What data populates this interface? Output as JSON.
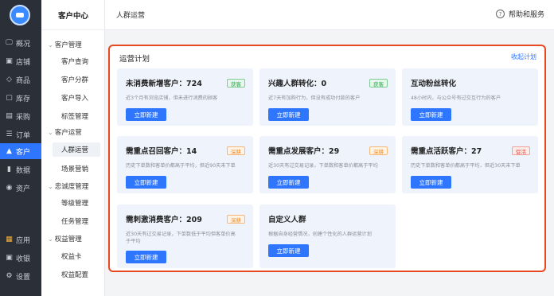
{
  "colors": {
    "accent": "#2f76ff",
    "highlight_border": "#e8481f",
    "rail_bg": "#2b2f38"
  },
  "rail": {
    "items": [
      {
        "label": "概况",
        "icon": "monitor-icon",
        "glyph": "🖵"
      },
      {
        "label": "店铺",
        "icon": "store-icon",
        "glyph": "▣"
      },
      {
        "label": "商品",
        "icon": "tag-icon",
        "glyph": "◇"
      },
      {
        "label": "库存",
        "icon": "box-icon",
        "glyph": "▢"
      },
      {
        "label": "采购",
        "icon": "cart-icon",
        "glyph": "▤"
      },
      {
        "label": "订单",
        "icon": "order-icon",
        "glyph": "☰"
      },
      {
        "label": "客户",
        "icon": "user-icon",
        "glyph": "▲"
      },
      {
        "label": "数据",
        "icon": "chart-icon",
        "glyph": "▮"
      },
      {
        "label": "资产",
        "icon": "asset-icon",
        "glyph": "◉"
      },
      {
        "label": "应用",
        "icon": "apps-icon",
        "glyph": "▦"
      },
      {
        "label": "收银",
        "icon": "cashier-icon",
        "glyph": "▣"
      },
      {
        "label": "设置",
        "icon": "settings-icon",
        "glyph": "⚙"
      }
    ]
  },
  "side": {
    "header": "客户中心",
    "groups": [
      {
        "label": "客户管理",
        "items": [
          "客户查询",
          "客户分群",
          "客户导入",
          "标签管理"
        ]
      },
      {
        "label": "客户运营",
        "items": [
          "人群运营",
          "场景营销"
        ]
      },
      {
        "label": "忠诚度管理",
        "items": [
          "等级管理",
          "任务管理"
        ]
      },
      {
        "label": "权益管理",
        "items": [
          "权益卡",
          "权益配置"
        ]
      }
    ]
  },
  "top": {
    "title": "人群运营",
    "help": "帮助和服务"
  },
  "panel": {
    "title": "运营计划",
    "collapse": "收起计划",
    "cards": [
      {
        "title": "未消费新增客户：724",
        "desc": "近3个月有浏览店铺，但未进行消费的顾客",
        "tag": "获客",
        "tag_color": "green",
        "button": "立即新建"
      },
      {
        "title": "兴趣人群转化：0",
        "desc": "近7天有加购行为，但没有成功付款的客户",
        "tag": "获客",
        "tag_color": "green",
        "button": "立即新建"
      },
      {
        "title": "互动粉丝转化",
        "desc": "48小时内，与公众号有过交互行为的客户",
        "tag": "",
        "tag_color": "",
        "button": "立即新建"
      },
      {
        "title": "需重点召回客户：14",
        "desc": "历史下单数和客单价都高于平均，但近90天未下单",
        "tag": "深耕",
        "tag_color": "orange",
        "button": "立即新建"
      },
      {
        "title": "需重点发展客户：29",
        "desc": "近30天有过交易记录，下单数和客单价都高于平均",
        "tag": "深耕",
        "tag_color": "orange",
        "button": "立即新建"
      },
      {
        "title": "需重点活跃客户：27",
        "desc": "历史下单数和客单价都高于平均，但近30天未下单",
        "tag": "促活",
        "tag_color": "red",
        "button": "立即新建"
      },
      {
        "title": "需刺激消费客户：209",
        "desc": "近30天有过交易记录，下单数低于平均但客单价高于平均",
        "tag": "深耕",
        "tag_color": "orange",
        "button": "立即新建"
      },
      {
        "title": "自定义人群",
        "desc": "根据自身经营情况，创建个性化的人群运营计划",
        "tag": "",
        "tag_color": "",
        "button": "立即新建"
      }
    ]
  }
}
